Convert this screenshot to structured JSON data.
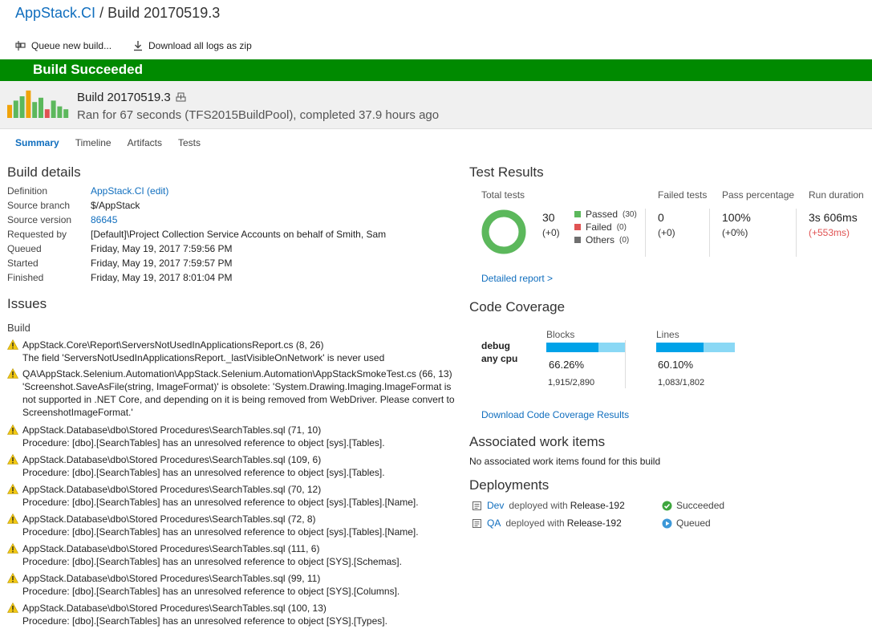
{
  "breadcrumb": {
    "project": "AppStack.CI",
    "separator": "/",
    "build": "Build 20170519.3"
  },
  "toolbar": {
    "queue_label": "Queue new build...",
    "download_label": "Download all logs as zip"
  },
  "banner": {
    "status": "Build Succeeded",
    "color": "#008a00"
  },
  "header": {
    "build_name": "Build 20170519.3",
    "summary": "Ran for 67 seconds (TFS2015BuildPool), completed 37.9 hours ago"
  },
  "tabs": [
    "Summary",
    "Timeline",
    "Artifacts",
    "Tests"
  ],
  "build_details": {
    "title": "Build details",
    "rows": [
      {
        "key": "Definition",
        "value": "AppStack.CI (edit)",
        "link": true
      },
      {
        "key": "Source branch",
        "value": "$/AppStack",
        "link": false
      },
      {
        "key": "Source version",
        "value": "86645",
        "link": true
      },
      {
        "key": "Requested by",
        "value": "[Default]\\Project Collection Service Accounts on behalf of Smith, Sam",
        "link": false
      },
      {
        "key": "Queued",
        "value": "Friday, May 19, 2017 7:59:56 PM",
        "link": false
      },
      {
        "key": "Started",
        "value": "Friday, May 19, 2017 7:59:57 PM",
        "link": false
      },
      {
        "key": "Finished",
        "value": "Friday, May 19, 2017 8:01:04 PM",
        "link": false
      }
    ]
  },
  "issues": {
    "title": "Issues",
    "group": "Build",
    "items": [
      {
        "line1": "AppStack.Core\\Report\\ServersNotUsedInApplicationsReport.cs (8, 26)",
        "line2": "The field 'ServersNotUsedInApplicationsReport._lastVisibleOnNetwork' is never used"
      },
      {
        "line1": "QA\\AppStack.Selenium.Automation\\AppStack.Selenium.Automation\\AppStackSmokeTest.cs (66, 13)",
        "line2": "'Screenshot.SaveAsFile(string, ImageFormat)' is obsolete: 'System.Drawing.Imaging.ImageFormat is not supported in .NET Core, and depending on it is being removed from WebDriver. Please convert to ScreenshotImageFormat.'"
      },
      {
        "line1": "AppStack.Database\\dbo\\Stored Procedures\\SearchTables.sql (71, 10)",
        "line2": "Procedure: [dbo].[SearchTables] has an unresolved reference to object [sys].[Tables]."
      },
      {
        "line1": "AppStack.Database\\dbo\\Stored Procedures\\SearchTables.sql (109, 6)",
        "line2": "Procedure: [dbo].[SearchTables] has an unresolved reference to object [sys].[Tables]."
      },
      {
        "line1": "AppStack.Database\\dbo\\Stored Procedures\\SearchTables.sql (70, 12)",
        "line2": "Procedure: [dbo].[SearchTables] has an unresolved reference to object [sys].[Tables].[Name]."
      },
      {
        "line1": "AppStack.Database\\dbo\\Stored Procedures\\SearchTables.sql (72, 8)",
        "line2": "Procedure: [dbo].[SearchTables] has an unresolved reference to object [sys].[Tables].[Name]."
      },
      {
        "line1": "AppStack.Database\\dbo\\Stored Procedures\\SearchTables.sql (111, 6)",
        "line2": "Procedure: [dbo].[SearchTables] has an unresolved reference to object [SYS].[Schemas]."
      },
      {
        "line1": "AppStack.Database\\dbo\\Stored Procedures\\SearchTables.sql (99, 11)",
        "line2": "Procedure: [dbo].[SearchTables] has an unresolved reference to object [SYS].[Columns]."
      },
      {
        "line1": "AppStack.Database\\dbo\\Stored Procedures\\SearchTables.sql (100, 13)",
        "line2": "Procedure: [dbo].[SearchTables] has an unresolved reference to object [SYS].[Types]."
      }
    ]
  },
  "test_results": {
    "title": "Test Results",
    "total_label": "Total tests",
    "total": "30",
    "total_delta": "(+0)",
    "legend": [
      {
        "label": "Passed",
        "count": "(30)",
        "color": "#5cb85c"
      },
      {
        "label": "Failed",
        "count": "(0)",
        "color": "#e05353"
      },
      {
        "label": "Others",
        "count": "(0)",
        "color": "#6f6f6f"
      }
    ],
    "pass_fraction": 1.0,
    "failed_label": "Failed tests",
    "failed": "0",
    "failed_delta": "(+0)",
    "pass_pct_label": "Pass percentage",
    "pass_pct": "100%",
    "pass_pct_delta": "(+0%)",
    "duration_label": "Run duration",
    "duration": "3s 606ms",
    "duration_delta": "(+553ms)",
    "report_link": "Detailed report >"
  },
  "code_coverage": {
    "title": "Code Coverage",
    "config": "debug",
    "platform": "any cpu",
    "blocks_label": "Blocks",
    "blocks_pct": "66.26%",
    "blocks_frac": 0.6626,
    "blocks_count": "1,915/2,890",
    "lines_label": "Lines",
    "lines_pct": "60.10%",
    "lines_frac": 0.601,
    "lines_count": "1,083/1,802",
    "download_link": "Download Code Coverage Results",
    "bar_color": "#00a2e8",
    "bar_bg": "#8ad8f5"
  },
  "work_items": {
    "title": "Associated work items",
    "empty": "No associated work items found for this build"
  },
  "deployments": {
    "title": "Deployments",
    "items": [
      {
        "env": "Dev",
        "middle": "deployed with",
        "release": "Release-192",
        "status": "Succeeded",
        "status_color": "#3ea63e"
      },
      {
        "env": "QA",
        "middle": "deployed with",
        "release": "Release-192",
        "status": "Queued",
        "status_color": "#3c98d8"
      }
    ]
  },
  "history_bars": [
    0.45,
    0.6,
    0.75,
    0.95,
    0.55,
    0.7,
    0.3,
    0.6,
    0.4,
    0.3
  ]
}
